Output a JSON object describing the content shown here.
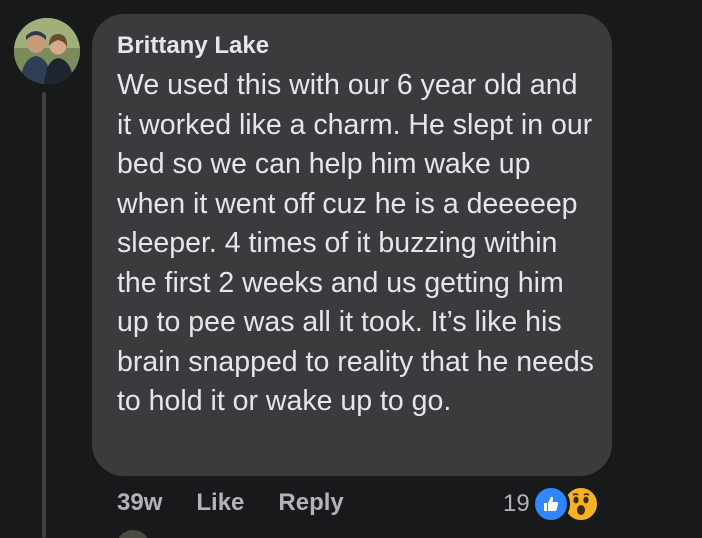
{
  "comment": {
    "author": "Brittany Lake",
    "text": "We used this with our 6 year old and it worked like a charm. He slept in our bed so we can help him wake up when it went off cuz he is a deeeeep sleeper. 4 times of it buzzing within the first 2 weeks and us getting him up to pee was all it took. It’s like his brain snapped to reality that he needs to hold it or wake up to go."
  },
  "actions": {
    "timestamp": "39w",
    "like_label": "Like",
    "reply_label": "Reply"
  },
  "reactions": {
    "count": "19",
    "icons": [
      "like-icon",
      "wow-icon"
    ]
  },
  "colors": {
    "background": "#18191a",
    "bubble": "#3a3b3c",
    "text": "#e4e6eb",
    "secondary_text": "#b0b3b8",
    "like_blue": "#2d88ff",
    "wow_yellow": "#f7b125"
  }
}
